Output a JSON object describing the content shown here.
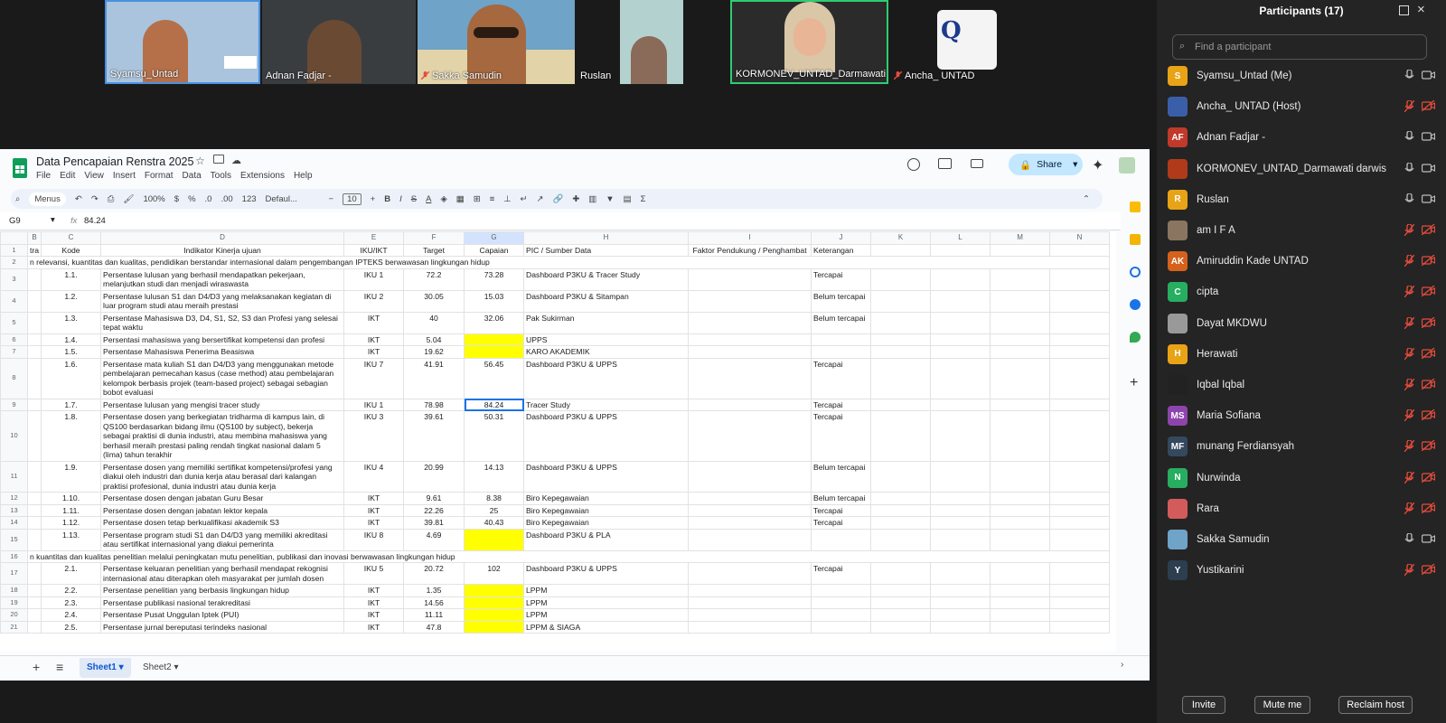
{
  "videos": [
    {
      "name": "Syamsu_Untad",
      "muted": false,
      "bg": "#a9c4dc"
    },
    {
      "name": "Adnan Fadjar -",
      "muted": false,
      "bg": "#3a3d40"
    },
    {
      "name": "Sakka Samudin",
      "muted": true,
      "bg": "#6fa3c7"
    },
    {
      "name": "Ruslan",
      "muted": false,
      "bg": "#1a1a1a"
    },
    {
      "name": "KORMONEV_UNTAD_Darmawati ...",
      "muted": false,
      "bg": "#2b2b2b"
    },
    {
      "name": "Ancha_ UNTAD",
      "muted": true,
      "bg": "#1a1a1a"
    }
  ],
  "sheet": {
    "title": "Data Pencapaian Renstra 2025",
    "menu": [
      "File",
      "Edit",
      "View",
      "Insert",
      "Format",
      "Data",
      "Tools",
      "Extensions",
      "Help"
    ],
    "share_label": "Share",
    "toolbar": {
      "menus": "Menus",
      "zoom": "100%",
      "currency": "$",
      "percent": "%",
      "dec_less": ".0",
      "dec_more": ".00",
      "numfmt": "123",
      "font": "Defaul...",
      "font_size": "10"
    },
    "cell_ref": "G9",
    "fx": "fx",
    "formula": "84.24",
    "col_letters": [
      "B",
      "C",
      "D",
      "E",
      "F",
      "G",
      "H",
      "I",
      "J",
      "K",
      "L",
      "M",
      "N"
    ],
    "headers": {
      "b": "tra",
      "c": "Kode",
      "d": "Indikator Kinerja ujuan",
      "e": "IKU/IKT",
      "f": "Target",
      "g": "Capaian",
      "h": "PIC / Sumber Data",
      "i": "Faktor Pendukung / Penghambat",
      "j": "Keterangan"
    },
    "section1": "n relevansi, kuantitas dan kualitas, pendidikan berstandar internasional dalam pengembangan IPTEKS berwawasan lingkungan hidup",
    "section2": "n kuantitas dan kualitas penelitian melalui peningkatan mutu penelitian, publikasi dan inovasi berwawasan lingkungan hidup",
    "rows": [
      {
        "rn": "3",
        "kode": "1.1.",
        "ind": "Persentase lulusan yang berhasil mendapatkan pekerjaan, melanjutkan studi dan menjadi wiraswasta",
        "iku": "IKU 1",
        "target": "72.2",
        "capaian": "73.28",
        "pic": "Dashboard P3KU & Tracer Study",
        "ket": "Tercapai"
      },
      {
        "rn": "4",
        "kode": "1.2.",
        "ind": "Persentase lulusan S1 dan D4/D3 yang melaksanakan kegiatan di luar program studi atau meraih prestasi",
        "iku": "IKU 2",
        "target": "30.05",
        "capaian": "15.03",
        "pic": "Dashboard P3KU & Sitampan",
        "ket": "Belum tercapai"
      },
      {
        "rn": "5",
        "kode": "1.3.",
        "ind": "Persentase Mahasiswa D3, D4, S1, S2, S3 dan Profesi yang selesai tepat waktu",
        "iku": "IKT",
        "target": "40",
        "capaian": "32.06",
        "pic": "Pak Sukirman",
        "ket": "Belum tercapai"
      },
      {
        "rn": "6",
        "kode": "1.4.",
        "ind": "Persentasi mahasiswa yang bersertifikat kompetensi dan profesi",
        "iku": "IKT",
        "target": "5.04",
        "capaian": "",
        "pic": "UPPS",
        "ket": ""
      },
      {
        "rn": "7",
        "kode": "1.5.",
        "ind": "Persentase Mahasiswa Penerima Beasiswa",
        "iku": "IKT",
        "target": "19.62",
        "capaian": "",
        "pic": "KARO AKADEMIK",
        "ket": ""
      },
      {
        "rn": "8",
        "kode": "1.6.",
        "ind": "Persentase mata kuliah S1 dan D4/D3 yang menggunakan metode pembelajaran pemecahan kasus (case method) atau pembelajaran kelompok berbasis projek (team-based project) sebagai sebagian bobot evaluasi",
        "iku": "IKU 7",
        "target": "41.91",
        "capaian": "56.45",
        "pic": "Dashboard P3KU & UPPS",
        "ket": "Tercapai"
      },
      {
        "rn": "9",
        "kode": "1.7.",
        "ind": "Persentase lulusan yang mengisi tracer study",
        "iku": "IKU 1",
        "target": "78.98",
        "capaian": "84.24",
        "pic": "Tracer Study",
        "ket": "Tercapai"
      },
      {
        "rn": "10",
        "kode": "1.8.",
        "ind": "Persentase dosen yang berkegiatan tridharma di kampus lain, di QS100 berdasarkan bidang ilmu (QS100 by subject), bekerja sebagai praktisi di dunia industri, atau membina mahasiswa yang berhasil meraih prestasi paling rendah tingkat nasional dalam 5 (lima) tahun terakhir",
        "iku": "IKU 3",
        "target": "39.61",
        "capaian": "50.31",
        "pic": "Dashboard P3KU & UPPS",
        "ket": "Tercapai"
      },
      {
        "rn": "11",
        "kode": "1.9.",
        "ind": "Persentase dosen yang memiliki sertifikat kompetensi/profesi yang diakui oleh industri dan dunia kerja atau berasal dari kalangan praktisi profesional, dunia industri atau dunia kerja",
        "iku": "IKU 4",
        "target": "20.99",
        "capaian": "14.13",
        "pic": "Dashboard P3KU & UPPS",
        "ket": "Belum tercapai"
      },
      {
        "rn": "12",
        "kode": "1.10.",
        "ind": "Persentase dosen dengan jabatan Guru Besar",
        "iku": "IKT",
        "target": "9.61",
        "capaian": "8.38",
        "pic": "Biro Kepegawaian",
        "ket": "Belum tercapai"
      },
      {
        "rn": "13",
        "kode": "1.11.",
        "ind": "Persentase dosen dengan jabatan lektor kepala",
        "iku": "IKT",
        "target": "22.26",
        "capaian": "25",
        "pic": "Biro Kepegawaian",
        "ket": "Tercapai"
      },
      {
        "rn": "14",
        "kode": "1.12.",
        "ind": "Persentase dosen tetap berkualifikasi akademik S3",
        "iku": "IKT",
        "target": "39.81",
        "capaian": "40.43",
        "pic": "Biro Kepegawaian",
        "ket": "Tercapai"
      },
      {
        "rn": "15",
        "kode": "1.13.",
        "ind": "Persentase program studi S1 dan D4/D3 yang memiliki akreditasi atau sertifikat internasional yang diakui pemerinta",
        "iku": "IKU 8",
        "target": "4.69",
        "capaian": "",
        "pic": "Dashboard P3KU & PLA",
        "ket": ""
      },
      {
        "rn": "17",
        "kode": "2.1.",
        "ind": "Persentase keluaran penelitian yang berhasil mendapat rekognisi internasional atau diterapkan oleh masyarakat per jumlah dosen",
        "iku": "IKU 5",
        "target": "20.72",
        "capaian": "102",
        "pic": "Dashboard P3KU & UPPS",
        "ket": "Tercapai"
      },
      {
        "rn": "18",
        "kode": "2.2.",
        "ind": "Persentase penelitian yang berbasis lingkungan hidup",
        "iku": "IKT",
        "target": "1.35",
        "capaian": "",
        "pic": "LPPM",
        "ket": ""
      },
      {
        "rn": "19",
        "kode": "2.3.",
        "ind": "Persentase publikasi nasional terakreditasi",
        "iku": "IKT",
        "target": "14.56",
        "capaian": "",
        "pic": "LPPM",
        "ket": ""
      },
      {
        "rn": "20",
        "kode": "2.4.",
        "ind": "Persentase Pusat Unggulan Iptek (PUI)",
        "iku": "IKT",
        "target": "11.11",
        "capaian": "",
        "pic": "LPPM",
        "ket": ""
      },
      {
        "rn": "21",
        "kode": "2.5.",
        "ind": "Persentase jurnal bereputasi terindeks nasional",
        "iku": "IKT",
        "target": "47.8",
        "capaian": "",
        "pic": "LPPM & SIAGA",
        "ket": ""
      }
    ],
    "tabs": [
      "Sheet1",
      "Sheet2"
    ]
  },
  "participants": {
    "title": "Participants (17)",
    "search_placeholder": "Find a participant",
    "list": [
      {
        "name": "Syamsu_Untad (Me)",
        "initials": "S",
        "color": "#e8a317",
        "muted": false
      },
      {
        "name": "Ancha_ UNTAD (Host)",
        "initials": "",
        "color": "#3a5fa8",
        "muted": true
      },
      {
        "name": "Adnan Fadjar -",
        "initials": "AF",
        "color": "#c0392b",
        "muted": false
      },
      {
        "name": "KORMONEV_UNTAD_Darmawati darwis",
        "initials": "",
        "color": "#b03a1a",
        "muted": false
      },
      {
        "name": "Ruslan",
        "initials": "R",
        "color": "#e8a317",
        "muted": false
      },
      {
        "name": "am I F A",
        "initials": "",
        "color": "#8a7560",
        "muted": true
      },
      {
        "name": "Amiruddin Kade UNTAD",
        "initials": "AK",
        "color": "#d4621c",
        "muted": true
      },
      {
        "name": "cipta",
        "initials": "C",
        "color": "#27ae60",
        "muted": true
      },
      {
        "name": "Dayat MKDWU",
        "initials": "",
        "color": "#999999",
        "muted": true
      },
      {
        "name": "Herawati",
        "initials": "H",
        "color": "#e8a317",
        "muted": true
      },
      {
        "name": "Iqbal Iqbal",
        "initials": "",
        "color": "#222222",
        "muted": true
      },
      {
        "name": "Maria Sofiana",
        "initials": "MS",
        "color": "#8e44ad",
        "muted": true
      },
      {
        "name": "munang Ferdiansyah",
        "initials": "MF",
        "color": "#34495e",
        "muted": true
      },
      {
        "name": "Nurwinda",
        "initials": "N",
        "color": "#27ae60",
        "muted": true
      },
      {
        "name": "Rara",
        "initials": "",
        "color": "#d35b5b",
        "muted": true
      },
      {
        "name": "Sakka Samudin",
        "initials": "",
        "color": "#6fa3c7",
        "muted": false
      },
      {
        "name": "Yustikarini",
        "initials": "Y",
        "color": "#2c3e50",
        "muted": true
      }
    ],
    "invite": "Invite",
    "mute_me": "Mute me",
    "reclaim": "Reclaim host"
  }
}
